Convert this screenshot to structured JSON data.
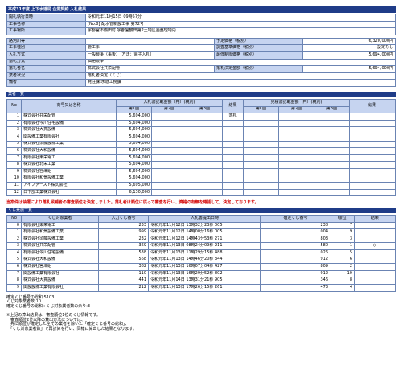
{
  "title": "平成31年度 上下水道局 企業契約 入札結果",
  "info": {
    "rows": [
      {
        "label": "開札執行日時",
        "value": "令和元年11月15日 09時57分"
      },
      {
        "label": "工事名称",
        "value": "[No.8] 配水管新設工事 第72号"
      },
      {
        "label": "工事場所",
        "value": "宇都宮市鶴田町 宇都宮鶴田第2土地区画整理地内"
      }
    ],
    "rows2": [
      {
        "l1": "路河川等",
        "v1": "",
        "l2": "予定価格（税別）",
        "v2": "6,320,000円"
      },
      {
        "l1": "工事種別",
        "v1": "管工事",
        "l2": "調査基準価格（税別）",
        "v2": "設定なし"
      },
      {
        "l1": "入札方式",
        "v1": "一般競争（事後）（方法：電子入札）",
        "l2": "最低制限価格（税別）",
        "v2": "5,694,000円"
      },
      {
        "l1": "落札方式",
        "v1": "価格競争",
        "l2": "",
        "v2": ""
      },
      {
        "l1": "落札者名",
        "v1": "株式会社共栄配管",
        "l2": "落札決定金額（税別）",
        "v2": "5,694,000円"
      },
      {
        "l1": "業者状況",
        "v1": "落札者決定（くじ）",
        "l2": "",
        "v2": ""
      },
      {
        "l1": "備考",
        "v1": "発注課:水道工務課",
        "l2": "",
        "v2": ""
      }
    ]
  },
  "bidders_title": "業者一覧",
  "bidders_header": {
    "no": "No",
    "name": "商号又は名称",
    "bid_group": "入札書記載金額（円）(税別)",
    "r1": "第1回",
    "r2": "第2回",
    "r3": "第3回",
    "result": "結果",
    "survey_group": "見積書記載金額（円）(税別)",
    "s1": "第1回",
    "s2": "第2回",
    "s3": "第3回",
    "result2": "結果"
  },
  "bidders": [
    {
      "no": "1",
      "name": "株式会社共栄配管",
      "r1": "5,694,000",
      "result": "落札"
    },
    {
      "no": "2",
      "name": "有限会社今川住宅設備",
      "r1": "5,694,000",
      "result": ""
    },
    {
      "no": "3",
      "name": "株式会社大貫設備",
      "r1": "5,694,000",
      "result": ""
    },
    {
      "no": "4",
      "name": "関設備工業有限会社",
      "r1": "5,694,000",
      "result": ""
    },
    {
      "no": "5",
      "name": "株式会社須藤設備工業",
      "r1": "5,694,000",
      "result": ""
    },
    {
      "no": "6",
      "name": "株式会社大和設備",
      "r1": "5,694,000",
      "result": ""
    },
    {
      "no": "7",
      "name": "有限会社東栄電工",
      "r1": "5,694,000",
      "result": ""
    },
    {
      "no": "8",
      "name": "株式会社北栄工業",
      "r1": "5,694,000",
      "result": ""
    },
    {
      "no": "9",
      "name": "株式会社宮津組",
      "r1": "5,694,000",
      "result": ""
    },
    {
      "no": "10",
      "name": "有限会社和気設備工業",
      "r1": "5,694,000",
      "result": ""
    },
    {
      "no": "11",
      "name": "アイファースト株式会社",
      "r1": "5,695,000",
      "result": ""
    },
    {
      "no": "12",
      "name": "日下部工業株式会社",
      "r1": "6,130,000",
      "result": ""
    }
  ],
  "notice": "当案件は抽選により落札候補者の審査順位を決定しました。落札者は順位に従って審査を行い、資格の有無を確認して、決定しております。",
  "lottery_title": "くじ実施一覧",
  "lottery_header": {
    "no": "No",
    "name": "くじ対象業者",
    "entry": "入力くじ番号",
    "time": "入札書提出日時",
    "confirm": "確定くじ番号",
    "rank": "順位",
    "result": "結果"
  },
  "lottery": [
    {
      "no": "0",
      "name": "有限会社東栄電工",
      "entry": "233",
      "time": "令和元年11月12日 13時32分23秒 005",
      "confirm": "238",
      "rank": "7",
      "result": ""
    },
    {
      "no": "1",
      "name": "有限会社和気設備工業",
      "entry": "999",
      "time": "令和元年11月12日 14時00分16秒 005",
      "confirm": "004",
      "rank": "9",
      "result": ""
    },
    {
      "no": "2",
      "name": "株式会社須藤設備工業",
      "entry": "232",
      "time": "令和元年11月12日 14時43分53秒 271",
      "confirm": "803",
      "rank": "3",
      "result": ""
    },
    {
      "no": "3",
      "name": "株式会社共栄配管",
      "entry": "369",
      "time": "令和元年11月13日 08時24分09秒 211",
      "confirm": "580",
      "rank": "1",
      "result": "○"
    },
    {
      "no": "4",
      "name": "有限会社今川住宅設備",
      "entry": "538",
      "time": "令和元年11月13日 11時29分15秒 488",
      "confirm": "026",
      "rank": "5",
      "result": ""
    },
    {
      "no": "5",
      "name": "株式会社大和設備",
      "entry": "568",
      "time": "令和元年11月13日 14時46分20秒 344",
      "confirm": "912",
      "rank": "6",
      "result": ""
    },
    {
      "no": "6",
      "name": "株式会社宮津組",
      "entry": "382",
      "time": "令和元年11月13日 16時07分04秒 427",
      "confirm": "809",
      "rank": "2",
      "result": ""
    },
    {
      "no": "7",
      "name": "関設備工業有限会社",
      "entry": "110",
      "time": "令和元年11月13日 16時29分52秒 802",
      "confirm": "912",
      "rank": "10",
      "result": ""
    },
    {
      "no": "8",
      "name": "株式会社大貫設備",
      "entry": "441",
      "time": "令和元年11月14日 13時31分21秒 905",
      "confirm": "346",
      "rank": "8",
      "result": ""
    },
    {
      "no": "9",
      "name": "関設設備工業有限会社",
      "entry": "212",
      "time": "令和元年11月13日 17時26分15秒 261",
      "confirm": "473",
      "rank": "4",
      "result": ""
    }
  ],
  "summary": [
    "確定くじ番号の総和:5103",
    "くじ対象業者数:10",
    "確定くじ番号の総和÷くじ対象業者数の余り:3"
  ],
  "footnote": [
    "※上記の算出結果は、審査順位1位のくじ情報です。",
    "　審査順位2位以降の算出方法については、",
    "　先に順位が確定した全ての業者を除いた「確定くじ番号の総和」、",
    "　「くじ対象業者数」で再計算を行い、同様に算出した結果となります。"
  ]
}
